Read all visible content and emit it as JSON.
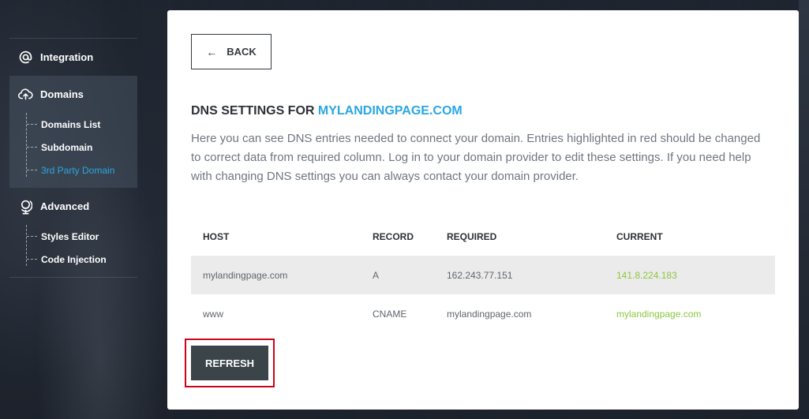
{
  "sidebar": {
    "integration": {
      "label": "Integration",
      "icon": "at-icon"
    },
    "domains": {
      "label": "Domains",
      "icon": "cloud-upload-icon",
      "items": [
        {
          "label": "Domains List"
        },
        {
          "label": "Subdomain"
        },
        {
          "label": "3rd Party Domain",
          "active": true
        }
      ]
    },
    "advanced": {
      "label": "Advanced",
      "icon": "globe-icon",
      "items": [
        {
          "label": "Styles Editor"
        },
        {
          "label": "Code Injection"
        }
      ]
    }
  },
  "main": {
    "back_label": "BACK",
    "title_prefix": "DNS SETTINGS FOR",
    "title_domain": "MYLANDINGPAGE.COM",
    "description": "Here you can see DNS entries needed to connect your domain. Entries highlighted in red should be changed to correct data from required column. Log in to your domain provider to edit these settings. If you need help with changing DNS settings you can always contact your domain provider.",
    "table": {
      "headers": {
        "host": "HOST",
        "record": "RECORD",
        "required": "REQUIRED",
        "current": "CURRENT"
      },
      "rows": [
        {
          "host": "mylandingpage.com",
          "record": "A",
          "required": "162.243.77.151",
          "current": "141.8.224.183"
        },
        {
          "host": "www",
          "record": "CNAME",
          "required": "mylandingpage.com",
          "current": "mylandingpage.com"
        }
      ]
    },
    "refresh_label": "REFRESH"
  },
  "colors": {
    "accent": "#2aa7e0",
    "match": "#8cc63f",
    "highlight": "#d0021b",
    "button_dark": "#3a4449"
  }
}
